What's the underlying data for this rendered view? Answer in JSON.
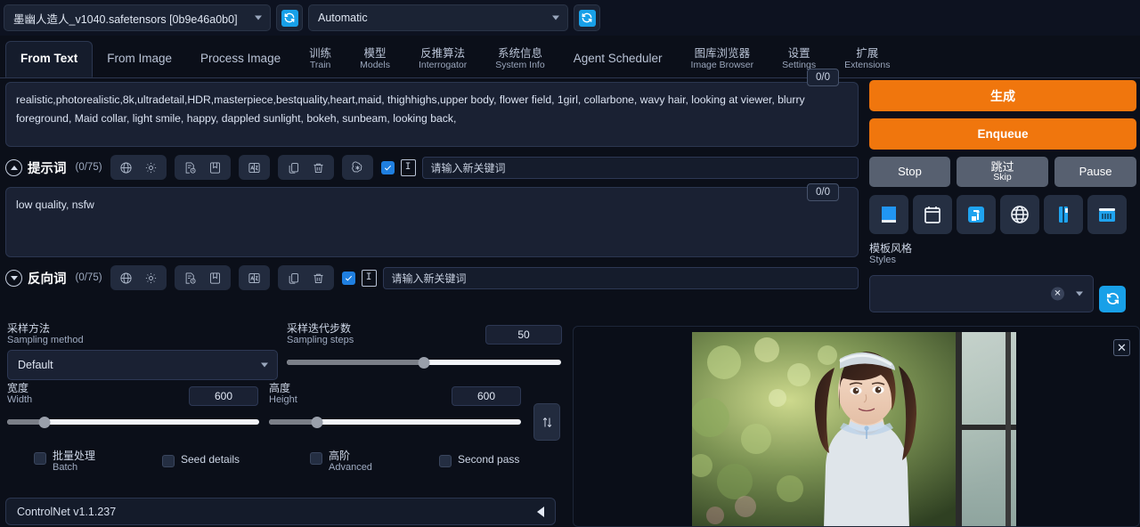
{
  "topbar": {
    "model_value": "墨幽人造人_v1040.safetensors [0b9e46a0b0]",
    "vae_value": "Automatic",
    "model_refresh_icon": "refresh-icon",
    "vae_refresh_icon": "refresh-icon"
  },
  "tabs": [
    {
      "cn": "",
      "en": "From Text",
      "active": true
    },
    {
      "cn": "",
      "en": "From Image",
      "active": false
    },
    {
      "cn": "",
      "en": "Process Image",
      "active": false
    },
    {
      "cn": "训练",
      "en": "Train",
      "active": false
    },
    {
      "cn": "模型",
      "en": "Models",
      "active": false
    },
    {
      "cn": "反推算法",
      "en": "Interrogator",
      "active": false
    },
    {
      "cn": "系统信息",
      "en": "System Info",
      "active": false
    },
    {
      "cn": "",
      "en": "Agent Scheduler",
      "active": false
    },
    {
      "cn": "图库浏览器",
      "en": "Image Browser",
      "active": false
    },
    {
      "cn": "设置",
      "en": "Settings",
      "active": false
    },
    {
      "cn": "扩展",
      "en": "Extensions",
      "active": false
    }
  ],
  "badges": {
    "top": "0/0",
    "lower": "0/0"
  },
  "prompt": {
    "text": "realistic,photorealistic,8k,ultradetail,HDR,masterpiece,bestquality,heart,maid, thighhighs,upper body, flower field, 1girl, collarbone, wavy hair, looking at viewer, blurry foreground,  Maid collar,  light smile, happy, dappled sunlight, bokeh, sunbeam, looking back,",
    "label": "提示词",
    "count": "(0/75)",
    "chevron_icon": "chevron-up-icon",
    "icons": [
      "globe-icon",
      "gear-icon",
      "history-icon",
      "bookmark-icon",
      "translate-icon",
      "copy-icon",
      "trash-icon",
      "openai-icon"
    ],
    "keyword_placeholder": "请输入新关键词",
    "keyword_checked": true
  },
  "negative": {
    "text": "low quality, nsfw",
    "label": "反向词",
    "count": "(0/75)",
    "chevron_icon": "chevron-down-icon",
    "icons": [
      "globe-icon",
      "gear-icon",
      "history-icon",
      "bookmark-icon",
      "translate-icon",
      "copy-icon",
      "trash-icon"
    ],
    "keyword_placeholder": "请输入新关键词",
    "keyword_checked": true
  },
  "params": {
    "sampling_method": {
      "cn": "采样方法",
      "en": "Sampling method",
      "value": "Default"
    },
    "sampling_steps": {
      "cn": "采样迭代步数",
      "en": "Sampling steps",
      "value": "50",
      "percent": 50
    },
    "width": {
      "cn": "宽度",
      "en": "Width",
      "value": "600",
      "percent": 15
    },
    "height": {
      "cn": "高度",
      "en": "Height",
      "value": "600",
      "percent": 19
    },
    "swap_icon": "swap-vertical-icon",
    "checkboxes": [
      {
        "cn": "批量处理",
        "en": "Batch",
        "checked": false
      },
      {
        "cn": "",
        "en": "Seed details",
        "checked": false
      },
      {
        "cn": "高阶",
        "en": "Advanced",
        "checked": false
      },
      {
        "cn": "",
        "en": "Second pass",
        "checked": false
      }
    ]
  },
  "controlnet": {
    "label": "ControlNet v1.1.237",
    "toggle_icon": "triangle-left-icon"
  },
  "actions": {
    "generate": "生成",
    "enqueue": "Enqueue",
    "stop": "Stop",
    "skip_cn": "跳过",
    "skip_en": "Skip",
    "pause": "Pause",
    "accent": "#f0760d",
    "icons": [
      "book-icon",
      "notepad-icon",
      "trash-bin-icon",
      "globe-icon",
      "clipboard-icon",
      "archive-icon"
    ]
  },
  "styles": {
    "cn": "模板风格",
    "en": "Styles",
    "value": "",
    "clear_icon": "clear-x-icon",
    "caret_icon": "chevron-down-icon",
    "refresh_icon": "refresh-icon"
  },
  "preview": {
    "close_icon": "close-icon",
    "alt": "generated-portrait"
  }
}
